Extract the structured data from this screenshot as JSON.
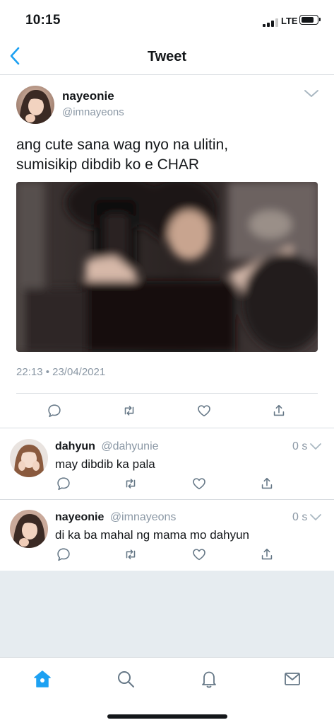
{
  "status_bar": {
    "time": "10:15",
    "network": "LTE",
    "battery_level": 0.85
  },
  "nav": {
    "title": "Tweet",
    "back_icon": "chevron-left-icon"
  },
  "main_tweet": {
    "author": {
      "name": "nayeonie",
      "handle": "@imnayeons"
    },
    "text_lines": [
      "ang cute sana wag nyo na ulitin,",
      "sumisikip dibdib ko e CHAR"
    ],
    "timestamp": "22:13 • 23/04/2021",
    "actions": [
      "reply-icon",
      "retweet-icon",
      "like-icon",
      "share-icon"
    ]
  },
  "replies": [
    {
      "name": "dahyun",
      "handle": "@dahyunie",
      "time": "0 s",
      "text": "may dibdib ka pala"
    },
    {
      "name": "nayeonie",
      "handle": "@imnayeons",
      "time": "0 s",
      "text": "di ka ba mahal ng mama mo dahyun"
    }
  ],
  "tab_bar": {
    "tabs": [
      "home-icon",
      "search-icon",
      "notifications-icon",
      "messages-icon"
    ],
    "active_tab": "home-icon"
  },
  "colors": {
    "accent": "#1da1f2",
    "icon_grey": "#657786",
    "text_secondary": "#8b98a5",
    "divider": "#d9dde1",
    "empty_bg": "#e6ecf0"
  }
}
